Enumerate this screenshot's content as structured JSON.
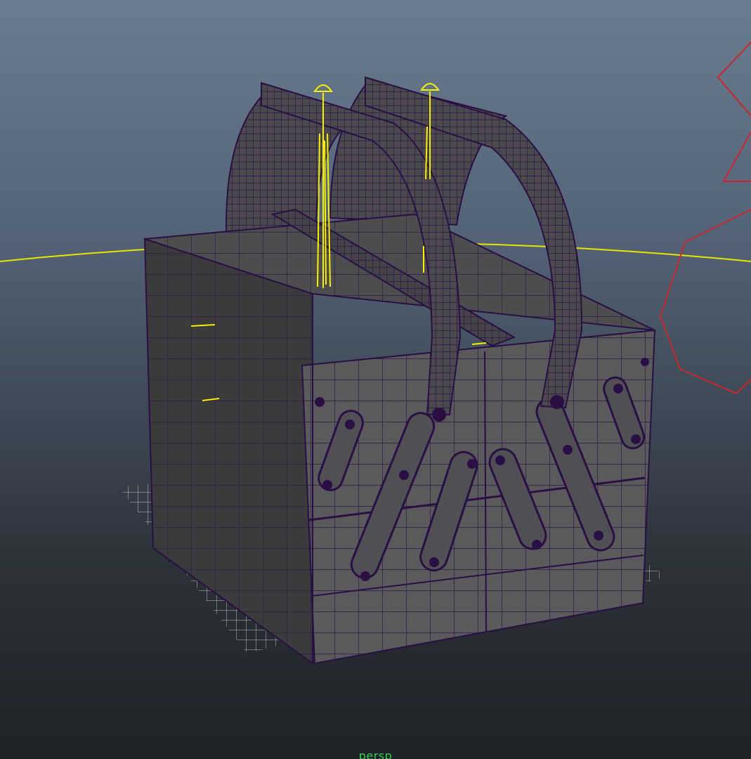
{
  "viewport": {
    "camera_label": "persp"
  },
  "scene": {
    "object": "toolbox",
    "colors": {
      "background_top": "#6c7c8f",
      "background_bottom": "#1f2226",
      "mesh_fill": "#5a5a5c",
      "mesh_fill_dark": "#3a3a3c",
      "wireframe": "#2a0f44",
      "ground_grid": "#d8d8d8",
      "horizon_line": "#e6e600",
      "joint_color": "#f5f000",
      "light_gizmo": "#c8282c",
      "camera_label": "#2fd05a"
    },
    "icons": [
      "joint-locator-icon",
      "light-gizmo-icon"
    ]
  }
}
